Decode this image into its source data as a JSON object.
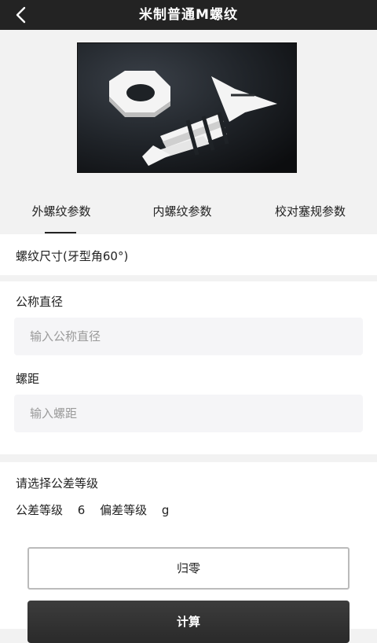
{
  "header": {
    "title": "米制普通M螺纹",
    "back_icon": "chevron-left-icon"
  },
  "hero": {
    "icon": "nut-and-screw-icon"
  },
  "tabs": [
    {
      "label": "外螺纹参数",
      "active": true
    },
    {
      "label": "内螺纹参数",
      "active": false
    },
    {
      "label": "校对塞规参数",
      "active": false
    }
  ],
  "thread_size": {
    "label": "螺纹尺寸(牙型角60°)"
  },
  "form": {
    "nominal_diameter": {
      "label": "公称直径",
      "value": "",
      "placeholder": "输入公称直径"
    },
    "pitch": {
      "label": "螺距",
      "value": "",
      "placeholder": "输入螺距"
    }
  },
  "tolerance": {
    "title": "请选择公差等级",
    "grade_label": "公差等级",
    "grade_value": "6",
    "deviation_label": "偏差等级",
    "deviation_value": "g"
  },
  "actions": {
    "reset_label": "归零",
    "calculate_label": "计算"
  }
}
